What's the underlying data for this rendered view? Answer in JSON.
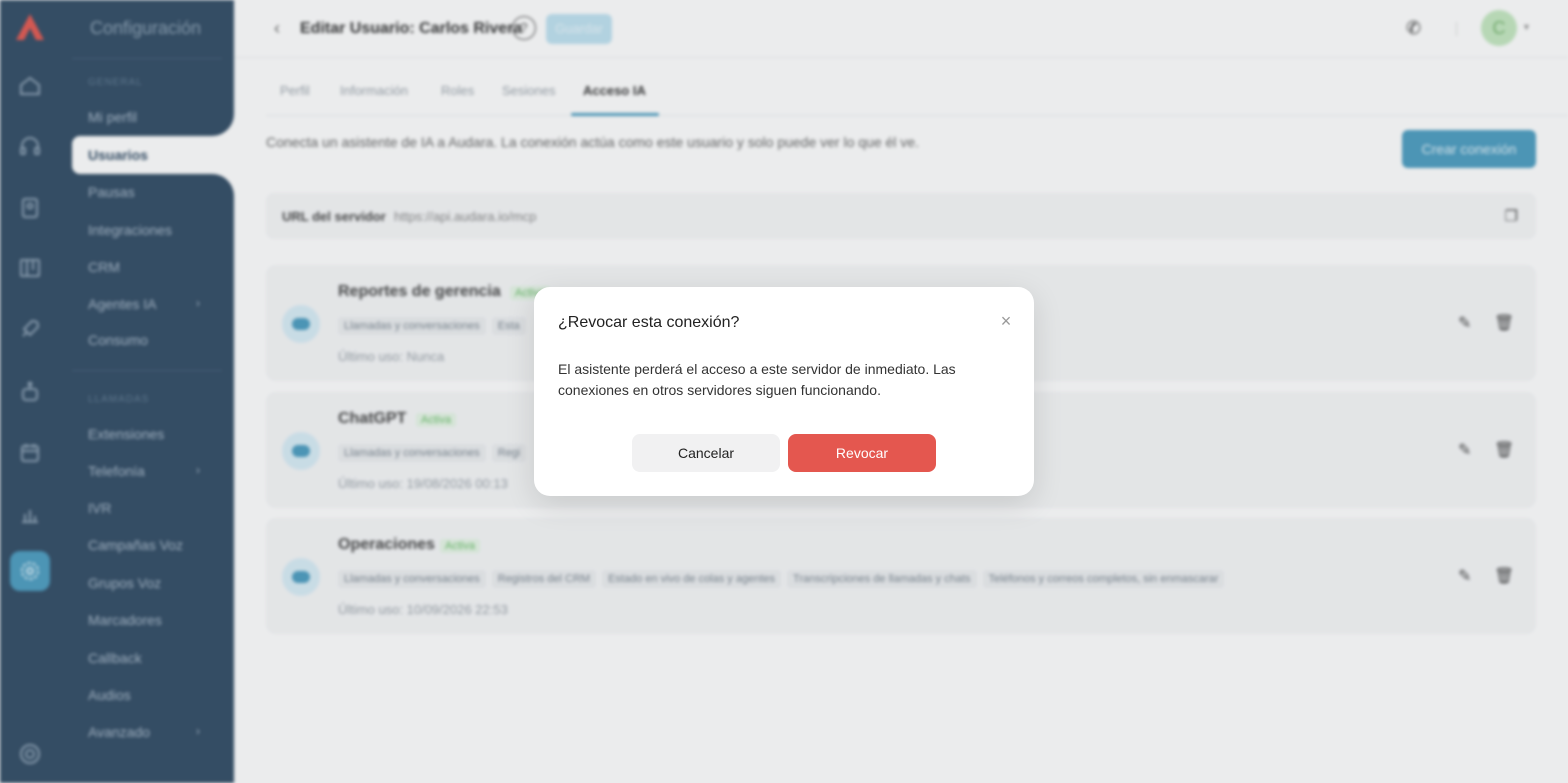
{
  "settings_menu": {
    "title": "Configuración",
    "section_general": "GENERAL",
    "section_llamadas": "LLAMADAS",
    "items_general": [
      "Mi perfil",
      "Usuarios",
      "Pausas",
      "Integraciones",
      "CRM",
      "Agentes IA",
      "Consumo"
    ],
    "items_llamadas": [
      "Extensiones",
      "Telefonía",
      "IVR",
      "Campañas Voz",
      "Grupos Voz",
      "Marcadores",
      "Callback",
      "Audios",
      "Avanzado"
    ],
    "active_item": "Usuarios"
  },
  "header": {
    "title": "Editar Usuario: Carlos Rivera",
    "help": "?",
    "save_label": "Guardar",
    "avatar_initial": "C"
  },
  "tabs": [
    "Perfil",
    "Información",
    "Roles",
    "Sesiones",
    "Acceso IA"
  ],
  "active_tab": "Acceso IA",
  "intro_text": "Conecta un asistente de IA a Audara. La conexión actúa como este usuario y solo puede ver lo que él ve.",
  "create_button": "Crear conexión",
  "server": {
    "label": "URL del servidor",
    "url": "https://api.audara.io/mcp"
  },
  "connections": [
    {
      "name": "Reportes de gerencia",
      "status": "Activa",
      "chips": [
        "Llamadas y conversaciones",
        "Esta"
      ],
      "last_used": "Último uso: Nunca"
    },
    {
      "name": "ChatGPT",
      "status": "Activa",
      "chips": [
        "Llamadas y conversaciones",
        "Regi"
      ],
      "last_used": "Último uso: 19/08/2026 00:13"
    },
    {
      "name": "Operaciones",
      "status": "Activa",
      "chips": [
        "Llamadas y conversaciones",
        "Registros del CRM",
        "Estado en vivo de colas y agentes",
        "Transcripciones de llamadas y chats",
        "Teléfonos y correos completos, sin enmascarar"
      ],
      "last_used": "Último uso: 10/09/2026 22:53"
    }
  ],
  "modal": {
    "title": "¿Revocar esta conexión?",
    "close": "×",
    "body": "El asistente perderá el acceso a este servidor de inmediato. Las conexiones en otros servidores siguen funcionando.",
    "cancel_label": "Cancelar",
    "revoke_label": "Revocar"
  },
  "colors": {
    "sidebar": "#2f4a63",
    "accent": "#4a9cc0",
    "danger": "#e4574f"
  },
  "icons": {
    "rail": [
      "home-icon",
      "headset-icon",
      "contacts-icon",
      "board-icon",
      "rocket-icon",
      "robot-icon",
      "calendar-icon",
      "chart-icon",
      "settings-icon",
      "help-circle-icon"
    ]
  }
}
